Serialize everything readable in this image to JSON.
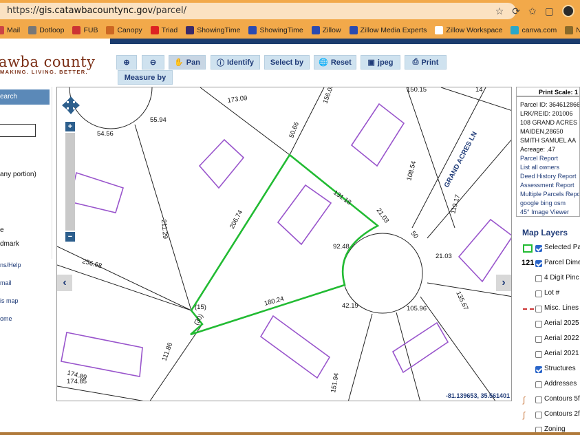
{
  "browser": {
    "url_prefix": "https://",
    "url_host": "gis.catawbacountync.gov",
    "url_path": "/parcel/",
    "bookmarks": [
      {
        "label": "Mail",
        "color": "#c44"
      },
      {
        "label": "Dotloop",
        "color": "#777"
      },
      {
        "label": "FUB",
        "color": "#c33"
      },
      {
        "label": "Canopy",
        "color": "#c62"
      },
      {
        "label": "Triad",
        "color": "#d22"
      },
      {
        "label": "ShowingTime",
        "color": "#3a2a6a"
      },
      {
        "label": "ShowingTime",
        "color": "#2a4ab0"
      },
      {
        "label": "Zillow",
        "color": "#2a4ab0"
      },
      {
        "label": "Zillow Media Experts",
        "color": "#2a4ab0"
      },
      {
        "label": "Zillow Workspace",
        "color": "#fff"
      },
      {
        "label": "canva.com",
        "color": "#2aa7c9"
      },
      {
        "label": "NCRE Manual",
        "color": "#8a6a2a"
      }
    ]
  },
  "header": {
    "logo_title": "awba county",
    "logo_sub": "MAKING. LIVING. BETTER."
  },
  "toolbar": {
    "zoom_in": "+",
    "zoom_out": "−",
    "pan": "Pan",
    "identify": "Identify",
    "select_by": "Select by",
    "reset": "Reset",
    "jpeg": "jpeg",
    "print": "Print",
    "measure_by": "Measure by"
  },
  "left_panel": {
    "search_tab": "earch",
    "option_any_portion": "any portion)",
    "option_e": "e",
    "option_landmark": "dmark",
    "links": [
      "ns/Help",
      "mail",
      "is map",
      "ome"
    ]
  },
  "map": {
    "coords": "-81.139653, 35.561401",
    "street_label": "GRAND ACRES LN",
    "dimensions": [
      "173.09",
      "55.94",
      "54.56",
      "150.15",
      "156.00",
      "50.66",
      "14",
      "108.54",
      "131.18",
      "21.03",
      "206.74",
      "211.29",
      "92.48",
      "50",
      "119.17",
      "21.03",
      "256.68",
      "(15)",
      "(30)",
      "180.24",
      "42.19",
      "105.96",
      "135.67",
      "111.86",
      "174.89",
      "174.85",
      "151.94"
    ]
  },
  "info": {
    "print_scale": "Print Scale: 1",
    "parcel_id": "Parcel ID: 364612866",
    "lrk": "LRK/REID: 201006",
    "address": "108 GRAND ACRES",
    "city": "MAIDEN,28650",
    "owner": "SMITH SAMUEL AA",
    "acreage": "Acreage: .47",
    "links": [
      "Parcel Report",
      "List all owners",
      "Deed History Report",
      "Assessment Report",
      "Multiple Parcels Repo",
      "google  bing  osm",
      "45° Image Viewer"
    ]
  },
  "layers": {
    "title": "Map Layers",
    "items": [
      {
        "label": "Selected Pa",
        "checked": true
      },
      {
        "label": "Parcel Dime",
        "checked": true
      },
      {
        "label": "4 Digit Pinc",
        "checked": false
      },
      {
        "label": "Lot #",
        "checked": false
      },
      {
        "label": "Misc. Lines",
        "checked": false
      },
      {
        "label": "Aerial 2025",
        "checked": false
      },
      {
        "label": "Aerial 2022",
        "checked": false
      },
      {
        "label": "Aerial 2021",
        "checked": false
      },
      {
        "label": "Structures",
        "checked": true
      },
      {
        "label": "Addresses",
        "checked": false
      },
      {
        "label": "Contours 5f",
        "checked": false
      },
      {
        "label": "Contours 2f",
        "checked": false
      },
      {
        "label": "Zoning",
        "checked": false
      }
    ],
    "dimension_swatch": "121"
  },
  "colors": {
    "selected_parcel": "#22bb33",
    "structure": "#9955cc",
    "link": "#1f3b78"
  }
}
